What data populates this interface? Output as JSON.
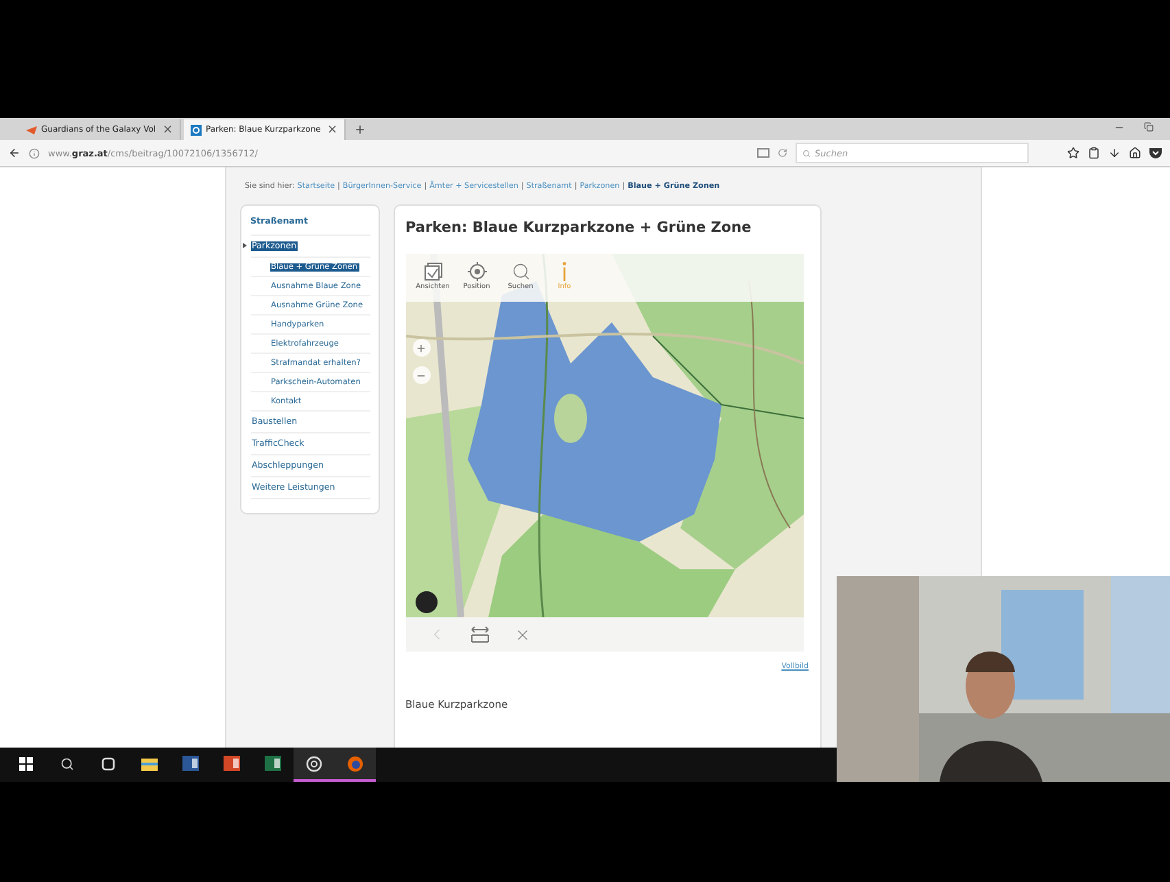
{
  "browser": {
    "tabs": [
      {
        "title": "Guardians of the Galaxy Vol",
        "close": "×",
        "selected": false
      },
      {
        "title": "Parken: Blaue Kurzparkzone",
        "close": "×",
        "selected": true
      }
    ],
    "url": "www.**graz.at**/cms/beitrag/10072106/1356712/",
    "search": {
      "placeholder": "Suchen"
    }
  },
  "breadcrumb": {
    "label": "Sie sind hier:",
    "separator": "|",
    "items": [
      {
        "text": "Startseite",
        "selected": false
      },
      {
        "text": "BürgerInnen-Service",
        "selected": false
      },
      {
        "text": "Ämter + Servicestellen",
        "selected": false
      },
      {
        "text": "Straßenamt",
        "selected": false
      },
      {
        "text": "Parkzonen",
        "selected": false
      },
      {
        "text": "Blaue + Grüne Zonen",
        "selected": true
      }
    ]
  },
  "sidebar": {
    "heading": "Straßenamt",
    "items": [
      {
        "label": "Parkzonen",
        "selected": true,
        "expanded": true,
        "children": [
          {
            "label": "Blaue + Grüne Zonen",
            "selected": true
          },
          {
            "label": "Ausnahme Blaue Zone",
            "selected": false
          },
          {
            "label": "Ausnahme Grüne Zone",
            "selected": false
          },
          {
            "label": "Handyparken",
            "selected": false
          },
          {
            "label": "Elektrofahrzeuge",
            "selected": false
          },
          {
            "label": "Strafmandat erhalten?",
            "selected": false
          },
          {
            "label": "Parkschein-Automaten",
            "selected": false
          },
          {
            "label": "Kontakt",
            "selected": false
          }
        ]
      },
      {
        "label": "Baustellen",
        "selected": false,
        "expanded": false
      },
      {
        "label": "TrafficCheck",
        "selected": false,
        "expanded": false
      },
      {
        "label": "Abschleppungen",
        "selected": false,
        "expanded": false
      },
      {
        "label": "Weitere Leistungen",
        "selected": false,
        "expanded": false
      }
    ]
  },
  "article": {
    "title": "Parken: Blaue Kurzparkzone + Grüne Zone",
    "map": {
      "tools": [
        {
          "kind": "views",
          "label": "Ansichten",
          "selected": false
        },
        {
          "kind": "position",
          "label": "Position",
          "selected": false
        },
        {
          "kind": "search",
          "label": "Suchen",
          "selected": false
        },
        {
          "kind": "info",
          "label": "Info",
          "selected": true
        }
      ],
      "nav": [
        {
          "kind": "back",
          "disabled": true
        },
        {
          "kind": "resize",
          "disabled": false
        },
        {
          "kind": "close",
          "disabled": false
        }
      ]
    },
    "fullscreen_link": "Vollbild",
    "section_heading": "Blaue Kurzparkzone"
  },
  "taskbar": [
    {
      "kind": "start",
      "running": false
    },
    {
      "kind": "search",
      "running": false
    },
    {
      "kind": "taskview",
      "running": false
    },
    {
      "kind": "explorer",
      "running": false
    },
    {
      "kind": "word",
      "running": false
    },
    {
      "kind": "powerpoint",
      "running": false
    },
    {
      "kind": "excel",
      "running": false
    },
    {
      "kind": "obs",
      "running": true
    },
    {
      "kind": "firefox",
      "running": true
    }
  ]
}
